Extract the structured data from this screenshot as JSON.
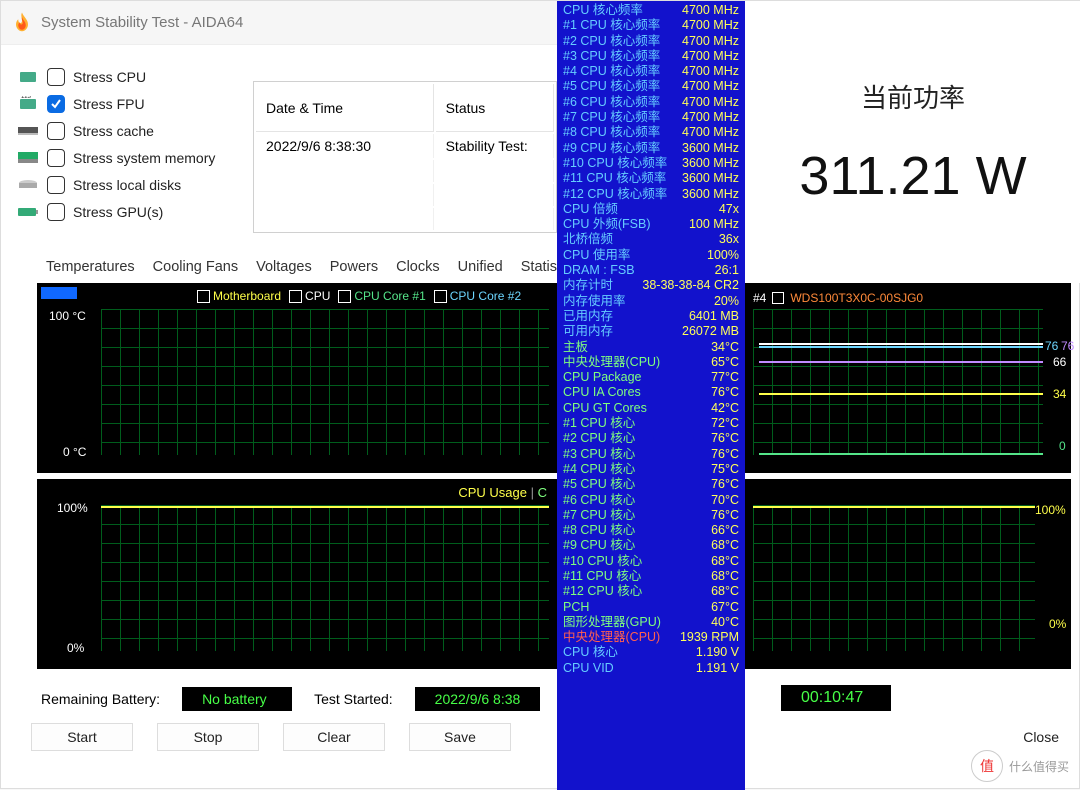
{
  "window": {
    "title": "System Stability Test - AIDA64"
  },
  "stress_options": [
    {
      "label": "Stress CPU",
      "checked": false,
      "icon": "chip-icon"
    },
    {
      "label": "Stress FPU",
      "checked": true,
      "icon": "chip123-icon"
    },
    {
      "label": "Stress cache",
      "checked": false,
      "icon": "ram-stick-icon"
    },
    {
      "label": "Stress system memory",
      "checked": false,
      "icon": "ram-module-icon"
    },
    {
      "label": "Stress local disks",
      "checked": false,
      "icon": "disk-icon"
    },
    {
      "label": "Stress GPU(s)",
      "checked": false,
      "icon": "gpu-card-icon"
    }
  ],
  "log": {
    "col1": "Date & Time",
    "col2": "Status",
    "r1c1": "2022/9/6 8:38:30",
    "r1c2": "Stability Test:"
  },
  "tabs": [
    "Temperatures",
    "Cooling Fans",
    "Voltages",
    "Powers",
    "Clocks",
    "Unified",
    "Statisti"
  ],
  "active_tab": "Temperatures",
  "temp_chart": {
    "y_top": "100 °C",
    "y_bot": "0 °C",
    "legend": [
      {
        "label": "Motherboard",
        "color": "#ffff4a"
      },
      {
        "label": "CPU",
        "color": "#ffffff"
      },
      {
        "label": "CPU Core #1",
        "color": "#55e58a"
      },
      {
        "label": "CPU Core #2",
        "color": "#6dd6ff"
      }
    ]
  },
  "usage_chart": {
    "title": "CPU Usage",
    "pipe": "C",
    "y_top": "100%",
    "y_bot": "0%"
  },
  "right_chart": {
    "legend_idx": "#4",
    "legend_name": "WDS100T3X0C-00SJG0",
    "r1": "76",
    "r1b": "76",
    "r2": "66",
    "r3": "34",
    "r4": "0"
  },
  "status": {
    "battery_label": "Remaining Battery:",
    "battery_val": "No battery",
    "started_label": "Test Started:",
    "started_val": "2022/9/6 8:38",
    "elapsed": "00:10:47"
  },
  "buttons": {
    "start": "Start",
    "stop": "Stop",
    "clear": "Clear",
    "save": "Save",
    "close": "Close"
  },
  "power": {
    "title": "当前功率",
    "value": "311.21 W"
  },
  "watermark": {
    "logo": "值",
    "text": "什么值得买"
  },
  "monitor_rows": [
    {
      "k": "CPU 核心频率",
      "v": "4700 MHz",
      "kc": "c-cyan"
    },
    {
      "k": "#1 CPU 核心频率",
      "v": "4700 MHz",
      "kc": "c-cyan"
    },
    {
      "k": "#2 CPU 核心频率",
      "v": "4700 MHz",
      "kc": "c-cyan"
    },
    {
      "k": "#3 CPU 核心频率",
      "v": "4700 MHz",
      "kc": "c-cyan"
    },
    {
      "k": "#4 CPU 核心频率",
      "v": "4700 MHz",
      "kc": "c-cyan"
    },
    {
      "k": "#5 CPU 核心频率",
      "v": "4700 MHz",
      "kc": "c-cyan"
    },
    {
      "k": "#6 CPU 核心频率",
      "v": "4700 MHz",
      "kc": "c-cyan"
    },
    {
      "k": "#7 CPU 核心频率",
      "v": "4700 MHz",
      "kc": "c-cyan"
    },
    {
      "k": "#8 CPU 核心频率",
      "v": "4700 MHz",
      "kc": "c-cyan"
    },
    {
      "k": "#9 CPU 核心频率",
      "v": "3600 MHz",
      "kc": "c-cyan"
    },
    {
      "k": "#10 CPU 核心频率",
      "v": "3600 MHz",
      "kc": "c-cyan"
    },
    {
      "k": "#11 CPU 核心频率",
      "v": "3600 MHz",
      "kc": "c-cyan"
    },
    {
      "k": "#12 CPU 核心频率",
      "v": "3600 MHz",
      "kc": "c-cyan"
    },
    {
      "k": "CPU 倍频",
      "v": "47x",
      "kc": "c-cyan"
    },
    {
      "k": "CPU 外频(FSB)",
      "v": "100 MHz",
      "kc": "c-cyan"
    },
    {
      "k": "北桥倍频",
      "v": "36x",
      "kc": "c-cyan"
    },
    {
      "k": "CPU 使用率",
      "v": "100%",
      "kc": "c-cyan"
    },
    {
      "k": "DRAM : FSB",
      "v": "26:1",
      "kc": "c-cyan"
    },
    {
      "k": "内存计时",
      "v": "38-38-38-84 CR2",
      "kc": "c-cyan"
    },
    {
      "k": "内存使用率",
      "v": "20%",
      "kc": "c-cyan"
    },
    {
      "k": "已用内存",
      "v": "6401 MB",
      "kc": "c-cyan"
    },
    {
      "k": "可用内存",
      "v": "26072 MB",
      "kc": "c-cyan"
    },
    {
      "k": "主板",
      "v": "34°C",
      "kc": "c-lime"
    },
    {
      "k": "中央处理器(CPU)",
      "v": "65°C",
      "kc": "c-lime"
    },
    {
      "k": "CPU Package",
      "v": "77°C",
      "kc": "c-lime"
    },
    {
      "k": "CPU IA Cores",
      "v": "76°C",
      "kc": "c-lime"
    },
    {
      "k": "CPU GT Cores",
      "v": "42°C",
      "kc": "c-lime"
    },
    {
      "k": "#1 CPU 核心",
      "v": "72°C",
      "kc": "c-lime"
    },
    {
      "k": "#2 CPU 核心",
      "v": "76°C",
      "kc": "c-lime"
    },
    {
      "k": "#3 CPU 核心",
      "v": "76°C",
      "kc": "c-lime"
    },
    {
      "k": "#4 CPU 核心",
      "v": "75°C",
      "kc": "c-lime"
    },
    {
      "k": "#5 CPU 核心",
      "v": "76°C",
      "kc": "c-lime"
    },
    {
      "k": "#6 CPU 核心",
      "v": "70°C",
      "kc": "c-lime"
    },
    {
      "k": "#7 CPU 核心",
      "v": "76°C",
      "kc": "c-lime"
    },
    {
      "k": "#8 CPU 核心",
      "v": "66°C",
      "kc": "c-lime"
    },
    {
      "k": "#9 CPU 核心",
      "v": "68°C",
      "kc": "c-lime"
    },
    {
      "k": "#10 CPU 核心",
      "v": "68°C",
      "kc": "c-lime"
    },
    {
      "k": "#11 CPU 核心",
      "v": "68°C",
      "kc": "c-lime"
    },
    {
      "k": "#12 CPU 核心",
      "v": "68°C",
      "kc": "c-lime"
    },
    {
      "k": "PCH",
      "v": "67°C",
      "kc": "c-lime"
    },
    {
      "k": "图形处理器(GPU)",
      "v": "40°C",
      "kc": "c-lime"
    },
    {
      "k": "中央处理器(CPU)",
      "v": "1939 RPM",
      "kc": "c-red"
    },
    {
      "k": "CPU 核心",
      "v": "1.190 V",
      "kc": "c-cyan"
    },
    {
      "k": "CPU VID",
      "v": "1.191 V",
      "kc": "c-cyan"
    }
  ]
}
